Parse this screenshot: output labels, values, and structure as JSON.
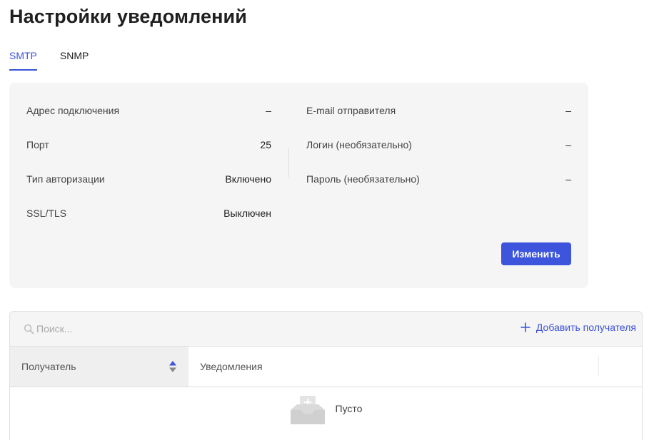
{
  "page": {
    "title": "Настройки уведомлений"
  },
  "tabs": [
    {
      "label": "SMTP",
      "active": true
    },
    {
      "label": "SNMP",
      "active": false
    }
  ],
  "smtp": {
    "left": [
      {
        "label": "Адрес подключения",
        "value": "–"
      },
      {
        "label": "Порт",
        "value": "25"
      },
      {
        "label": "Тип авторизации",
        "value": "Включено"
      },
      {
        "label": "SSL/TLS",
        "value": "Выключен"
      }
    ],
    "right": [
      {
        "label": "E-mail отправителя",
        "value": "–"
      },
      {
        "label": "Логин (необязательно)",
        "value": "–"
      },
      {
        "label": "Пароль (необязательно)",
        "value": "–"
      }
    ],
    "edit_label": "Изменить"
  },
  "recipients": {
    "search_placeholder": "Поиск...",
    "add_label": "Добавить получателя",
    "columns": [
      "Получатель",
      "Уведомления"
    ],
    "empty_text": "Пусто"
  },
  "colors": {
    "accent": "#3c55dc",
    "card_bg": "#f5f5f5"
  },
  "icons": [
    "search-icon",
    "plus-icon",
    "sort-icon",
    "empty-inbox-icon"
  ]
}
